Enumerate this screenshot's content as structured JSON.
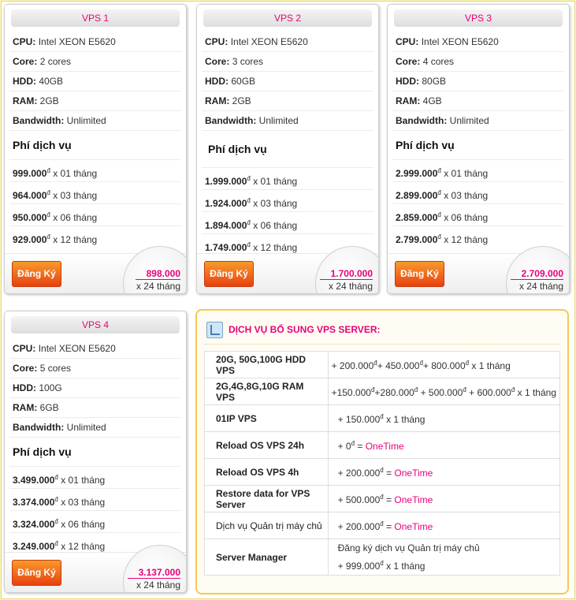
{
  "currency": "đ",
  "labels": {
    "cpu": "CPU:",
    "core": "Core:",
    "hdd": "HDD:",
    "ram": "RAM:",
    "bandwidth": "Bandwidth:",
    "fee": "Phí dịch vụ",
    "register": "Đăng Ký",
    "per24": "x 24 tháng"
  },
  "plans": [
    {
      "title": "VPS 1",
      "cpu": "Intel XEON E5620",
      "core": "2 cores",
      "hdd": "40GB",
      "ram": "2GB",
      "bandwidth": "Unlimited",
      "prices": [
        {
          "amount": "999.000",
          "term": "x 01 tháng"
        },
        {
          "amount": "964.000",
          "term": "x 03 tháng"
        },
        {
          "amount": "950.000",
          "term": "x 06 tháng"
        },
        {
          "amount": "929.000",
          "term": "x 12 tháng"
        }
      ],
      "total": "898.000"
    },
    {
      "title": "VPS 2",
      "cpu": "Intel XEON E5620",
      "core": "3 cores",
      "hdd": "60GB",
      "ram": "2GB",
      "bandwidth": "Unlimited",
      "prices": [
        {
          "amount": "1.999.000",
          "term": "x 01 tháng"
        },
        {
          "amount": "1.924.000",
          "term": "x 03 tháng"
        },
        {
          "amount": "1.894.000",
          "term": "x 06 tháng"
        },
        {
          "amount": "1.749.000",
          "term": "x 12 tháng"
        }
      ],
      "total": "1.700.000"
    },
    {
      "title": "VPS 3",
      "cpu": "Intel XEON E5620",
      "core": "4 cores",
      "hdd": "80GB",
      "ram": "4GB",
      "bandwidth": "Unlimited",
      "prices": [
        {
          "amount": "2.999.000",
          "term": "x 01 tháng"
        },
        {
          "amount": "2.899.000",
          "term": "x 03 tháng"
        },
        {
          "amount": "2.859.000",
          "term": "x 06 tháng"
        },
        {
          "amount": "2.799.000",
          "term": "x 12 tháng"
        }
      ],
      "total": "2.709.000"
    },
    {
      "title": "VPS 4",
      "cpu": "Intel XEON E5620",
      "core": "5 cores",
      "hdd": "100G",
      "ram": "6GB",
      "bandwidth": "Unlimited",
      "prices": [
        {
          "amount": "3.499.000",
          "term": "x 01 tháng"
        },
        {
          "amount": "3.374.000",
          "term": "x 03 tháng"
        },
        {
          "amount": "3.324.000",
          "term": "x 06 tháng"
        },
        {
          "amount": "3.249.000",
          "term": "x 12 tháng"
        }
      ],
      "total": "3.137.000"
    }
  ],
  "services": {
    "title": "DỊCH VỤ BỔ SUNG VPS SERVER:",
    "rows": [
      {
        "name": "20G, 50G,100G HDD VPS",
        "parts": [
          {
            "t": "+ 200.000",
            "s": true
          },
          {
            "t": "+ 450.000",
            "s": true
          },
          {
            "t": "+ 800.000",
            "s": true
          },
          {
            "t": " x 1 tháng"
          }
        ]
      },
      {
        "name": "2G,4G,8G,10G RAM VPS",
        "parts": [
          {
            "t": "+150.000",
            "s": true
          },
          {
            "t": "+280.000",
            "s": true
          },
          {
            "t": " + 500.000",
            "s": true
          },
          {
            "t": " + 600.000",
            "s": true
          },
          {
            "t": " x 1 tháng"
          }
        ]
      },
      {
        "name": "01IP VPS",
        "parts": [
          {
            "t": "+ 150.000",
            "s": true
          },
          {
            "t": " x 1 tháng"
          }
        ]
      },
      {
        "name": "Reload OS VPS 24h",
        "parts": [
          {
            "t": "+ 0",
            "s": true
          },
          {
            "t": " = "
          },
          {
            "t": "OneTime",
            "pink": true
          }
        ]
      },
      {
        "name": "Reload OS VPS 4h",
        "parts": [
          {
            "t": "+ 200.000",
            "s": true
          },
          {
            "t": " = "
          },
          {
            "t": "OneTime",
            "pink": true
          }
        ]
      },
      {
        "name": "Restore data for VPS Server",
        "parts": [
          {
            "t": "+ 500.000",
            "s": true
          },
          {
            "t": " = "
          },
          {
            "t": "OneTime",
            "pink": true
          }
        ]
      },
      {
        "name": "Dịch vụ Quản trị máy chủ",
        "normal": true,
        "parts": [
          {
            "t": "+ 200.000",
            "s": true
          },
          {
            "t": " = "
          },
          {
            "t": "OneTime",
            "pink": true
          }
        ]
      },
      {
        "name": "Server Manager",
        "line1": "Đăng ký dịch vụ Quản trị máy chủ",
        "parts": [
          {
            "t": "+ 999.000",
            "s": true
          },
          {
            "t": " x 1 tháng"
          }
        ]
      }
    ]
  }
}
